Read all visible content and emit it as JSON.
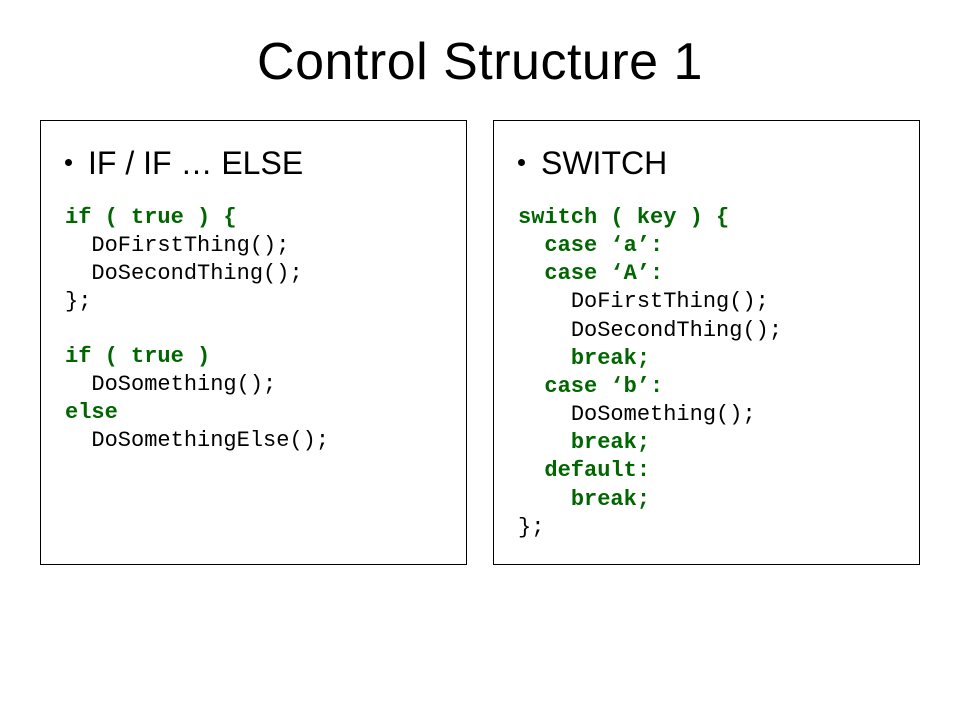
{
  "title": "Control Structure 1",
  "left": {
    "heading": "IF / IF … ELSE",
    "block1": {
      "l0": "if ( true ) {",
      "l1": "DoFirstThing();",
      "l2": "DoSecondThing();",
      "l3": "};"
    },
    "block2": {
      "l0": "if ( true )",
      "l1": "DoSomething();",
      "l2": "else",
      "l3": "DoSomethingElse();"
    }
  },
  "right": {
    "heading": "SWITCH",
    "code": {
      "l0": "switch ( key ) {",
      "l1": "case ‘a’:",
      "l2": "case ‘A’:",
      "l3": "DoFirstThing();",
      "l4": "DoSecondThing();",
      "l5": "break;",
      "l6": "case ‘b’:",
      "l7": "DoSomething();",
      "l8": "break;",
      "l9": "default:",
      "l10": "break;",
      "l11": "};"
    }
  },
  "colors": {
    "keyword": "#006600",
    "text": "#000000",
    "background": "#ffffff"
  }
}
